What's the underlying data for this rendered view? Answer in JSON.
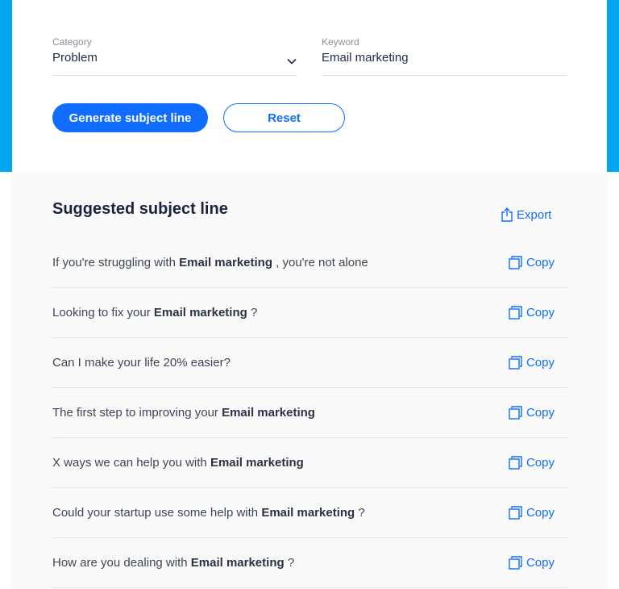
{
  "colors": {
    "accent": "#116dff",
    "band": "#00a6f0",
    "divider": "#e2e4e8"
  },
  "form": {
    "category": {
      "label": "Category",
      "value": "Problem",
      "icon": "chevron-down-icon"
    },
    "keyword": {
      "label": "Keyword",
      "value": "Email marketing"
    }
  },
  "buttons": {
    "generate": "Generate subject line",
    "reset": "Reset"
  },
  "results": {
    "title": "Suggested subject line",
    "export_label": "Export",
    "copy_label": "Copy",
    "items": [
      {
        "before": "If you're struggling with ",
        "keyword": "Email marketing",
        "after": " , you're not alone"
      },
      {
        "before": "Looking to fix your ",
        "keyword": "Email marketing",
        "after": " ?"
      },
      {
        "before": "Can I make your life 20% easier?",
        "keyword": "",
        "after": ""
      },
      {
        "before": "The first step to improving your ",
        "keyword": "Email marketing",
        "after": ""
      },
      {
        "before": "X ways we can help you with ",
        "keyword": "Email marketing",
        "after": ""
      },
      {
        "before": "Could your startup use some help with ",
        "keyword": "Email marketing",
        "after": " ?"
      },
      {
        "before": "How are you dealing with ",
        "keyword": "Email marketing",
        "after": " ?"
      }
    ]
  }
}
